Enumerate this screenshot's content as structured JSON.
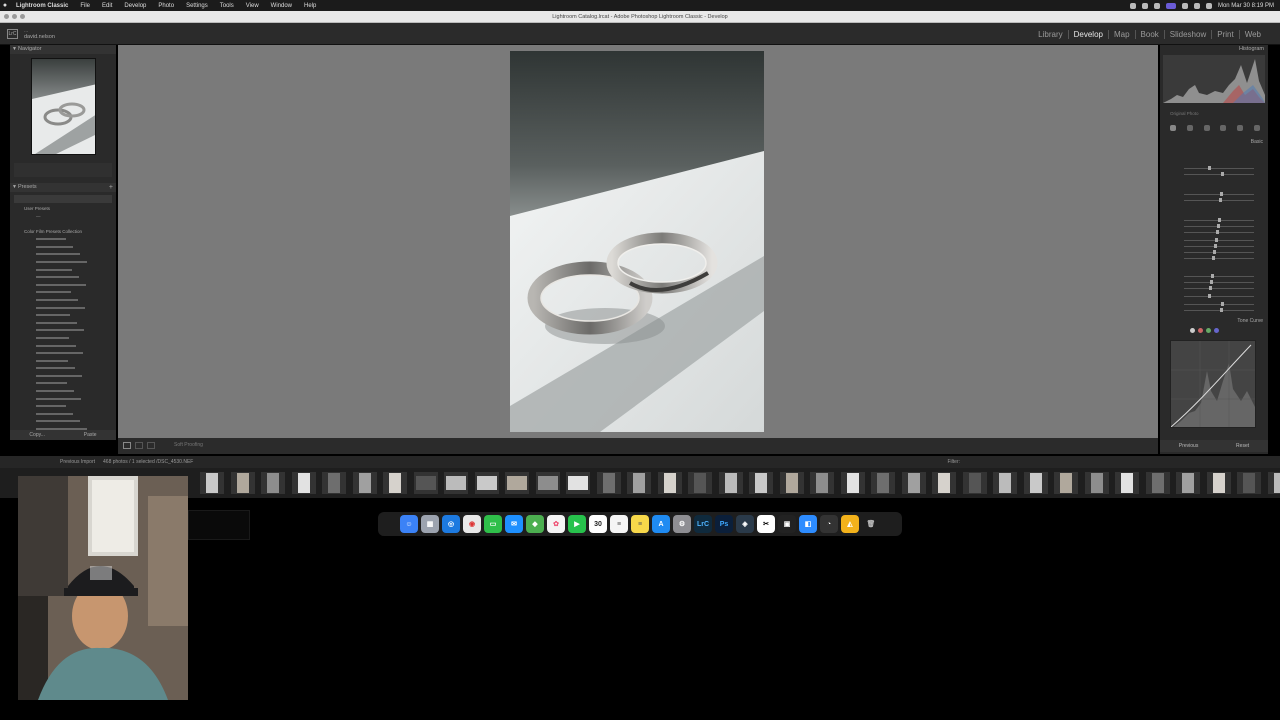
{
  "menubar": {
    "app_name": "Lightroom Classic",
    "items": [
      "File",
      "Edit",
      "Develop",
      "Photo",
      "Settings",
      "Tools",
      "View",
      "Window",
      "Help"
    ],
    "clock": "Mon Mar 30  8:19 PM"
  },
  "window": {
    "title": "Lightroom Catalog.lrcat - Adobe Photoshop Lightroom Classic - Develop"
  },
  "identity": {
    "logo": "LrC",
    "line1": "...",
    "line2": "david.nelson"
  },
  "modules": [
    {
      "label": "Library",
      "active": false
    },
    {
      "label": "Develop",
      "active": true
    },
    {
      "label": "Map",
      "active": false
    },
    {
      "label": "Book",
      "active": false
    },
    {
      "label": "Slideshow",
      "active": false
    },
    {
      "label": "Print",
      "active": false
    },
    {
      "label": "Web",
      "active": false
    }
  ],
  "left_panel": {
    "navigator_label": "Navigator",
    "presets_label": "Presets",
    "groups": [
      "User Presets",
      "Color Film Presets Collection"
    ],
    "copy_label": "Copy...",
    "paste_label": "Paste"
  },
  "toolbar": {
    "soft_proofing": "Soft Proofing"
  },
  "right_panel": {
    "histogram_label": "Histogram",
    "original_photo": "Original Photo",
    "basic_label": "Basic",
    "tone_curve_label": "Tone Curve",
    "previous_label": "Previous",
    "reset_label": "Reset"
  },
  "filmstrip": {
    "info": "Previous Import",
    "count": "468 photos / 1 selected /DSC_4530.NEF",
    "filter_label": "Filter:"
  },
  "dock": {
    "calendar_day": "30",
    "apps": [
      "finder",
      "launchpad",
      "safari",
      "chrome",
      "messages",
      "mail",
      "maps",
      "photos",
      "facetime",
      "calendar",
      "reminders",
      "notes",
      "app-store",
      "settings",
      "lightroom",
      "photoshop",
      "bridge",
      "capture",
      "screenshot",
      "zoom",
      "clock",
      "keynote",
      "trash"
    ]
  },
  "colors": {
    "accent": "#e6e6e6",
    "panel": "#2a2a2a",
    "canvas": "#7a7a7a"
  }
}
